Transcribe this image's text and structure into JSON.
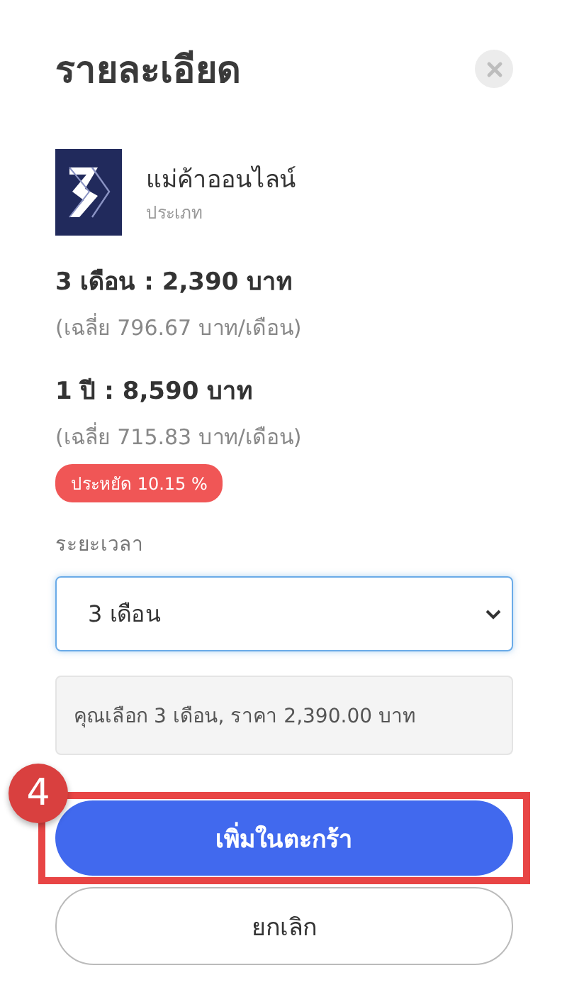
{
  "title": "รายละเอียด",
  "product": {
    "name": "แม่ค้าออนไลน์",
    "category": "ประเภท"
  },
  "plans": [
    {
      "label": "3 เดือน : 2,390 บาท",
      "average": "(เฉลี่ย 796.67 บาท/เดือน)"
    },
    {
      "label": "1 ปี : 8,590 บาท",
      "average": "(เฉลี่ย 715.83 บาท/เดือน)",
      "badge": "ประหยัด 10.15 %"
    }
  ],
  "duration": {
    "label": "ระยะเวลา",
    "value": "3 เดือน"
  },
  "summary": "คุณเลือก 3 เดือน, ราคา 2,390.00 บาท",
  "buttons": [
    {
      "kind": "primary",
      "label": "เพิ่มในตะกร้า",
      "highlighted": true,
      "step": "4"
    },
    {
      "kind": "secondary",
      "label": "ยกเลิก",
      "highlighted": false
    }
  ]
}
